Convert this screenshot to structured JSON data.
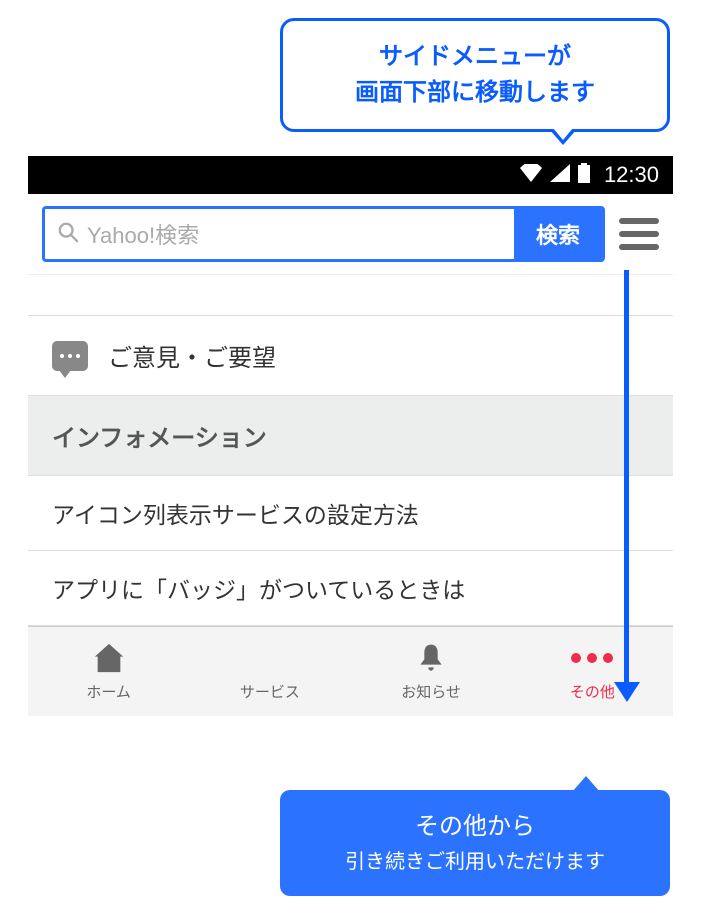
{
  "callout_top": {
    "line1": "サイドメニューが",
    "line2": "画面下部に移動します"
  },
  "status": {
    "time": "12:30"
  },
  "search": {
    "placeholder": "Yahoo!検索",
    "button": "検索"
  },
  "feedback": {
    "label": "ご意見・ご要望"
  },
  "section": {
    "header": "インフォメーション",
    "items": [
      "アイコン列表示サービスの設定方法",
      "アプリに「バッジ」がついているときは"
    ]
  },
  "nav": {
    "home": "ホーム",
    "service": "サービス",
    "notice": "お知らせ",
    "other": "その他"
  },
  "callout_bottom": {
    "line1": "その他から",
    "line2": "引き続きご利用いただけます"
  },
  "colors": {
    "primary": "#2b72ff",
    "accent": "#ef2b4a",
    "callout_border": "#0a5cff"
  }
}
